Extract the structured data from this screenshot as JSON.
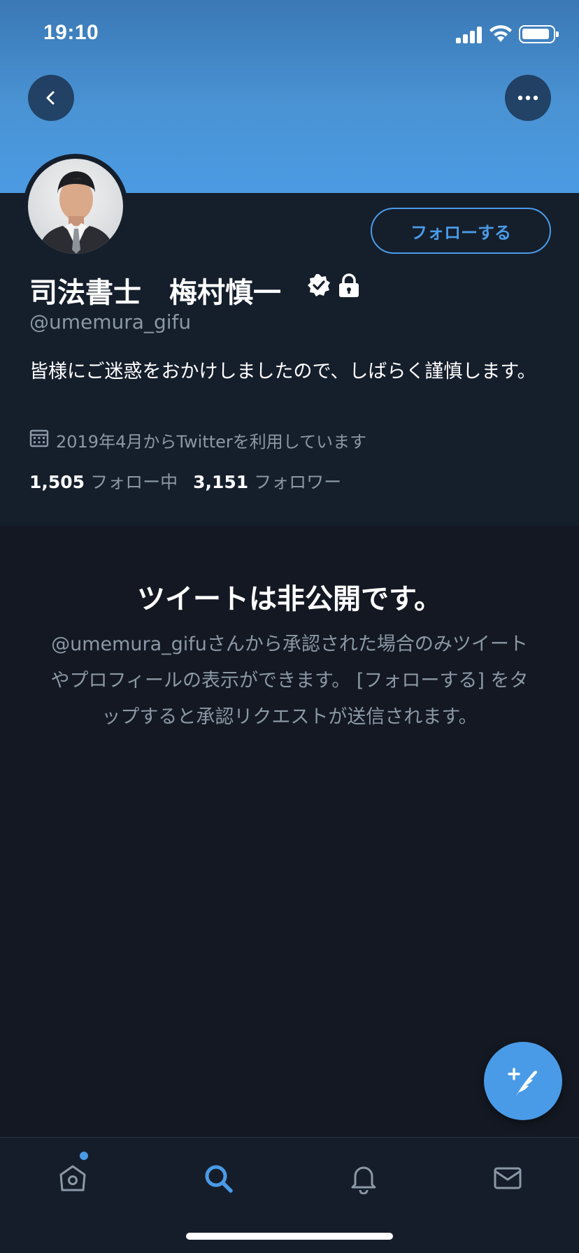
{
  "status_bar": {
    "time": "19:10"
  },
  "profile": {
    "display_name": "司法書士　梅村慎一",
    "handle": "@umemura_gifu",
    "bio": "皆様にご迷惑をおかけしましたので、しばらく謹慎します。",
    "joined": "2019年4月からTwitterを利用しています",
    "following_count": "1,505",
    "following_label": "フォロー中",
    "followers_count": "3,151",
    "followers_label": "フォロワー",
    "follow_button_label": "フォローする",
    "badges": [
      "verified-icon",
      "lock-icon"
    ]
  },
  "private_notice": {
    "title": "ツイートは非公開です。",
    "description": "@umemura_gifuさんから承認された場合のみツイートやプロフィールの表示ができます。 [フォローする] をタップすると承認リクエストが送信されます。"
  },
  "tabs": [
    {
      "name": "home",
      "icon": "home-icon",
      "active": false,
      "has_dot": true
    },
    {
      "name": "search",
      "icon": "search-icon",
      "active": true
    },
    {
      "name": "notifications",
      "icon": "bell-icon",
      "active": false
    },
    {
      "name": "messages",
      "icon": "mail-icon",
      "active": false
    }
  ],
  "colors": {
    "accent": "#4a9be7",
    "background": "#141923",
    "profile_background": "#151e2b",
    "secondary_text": "#8b98a5",
    "banner": "#4b9be3"
  }
}
